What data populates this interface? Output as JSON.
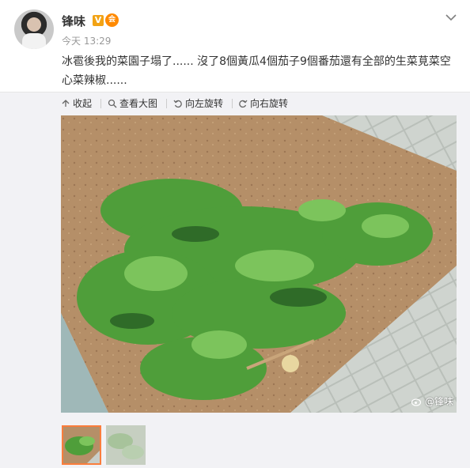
{
  "post": {
    "username": "锋味",
    "vip_badge": "V",
    "member_badge": "会",
    "timestamp": "今天 13:29",
    "text": "冰雹後我的菜園子塌了...... 沒了8個黃瓜4個茄子9個番茄還有全部的生菜莧菜空心菜辣椒......"
  },
  "toolbar": {
    "collapse_label": "收起",
    "view_large_label": "查看大图",
    "rotate_left_label": "向左旋转",
    "rotate_right_label": "向右旋转"
  },
  "image": {
    "watermark": "@锋味",
    "thumbnail_count": 2,
    "selected_thumbnail": 1
  },
  "colors": {
    "accent": "#fa7d3c",
    "vip": "#f2a315",
    "toolbar_bg": "#f2f2f5",
    "text": "#333333",
    "muted": "#999999"
  },
  "icons": [
    "chevron-down-icon",
    "collapse-icon",
    "magnify-icon",
    "rotate-left-icon",
    "rotate-right-icon",
    "weibo-icon"
  ]
}
